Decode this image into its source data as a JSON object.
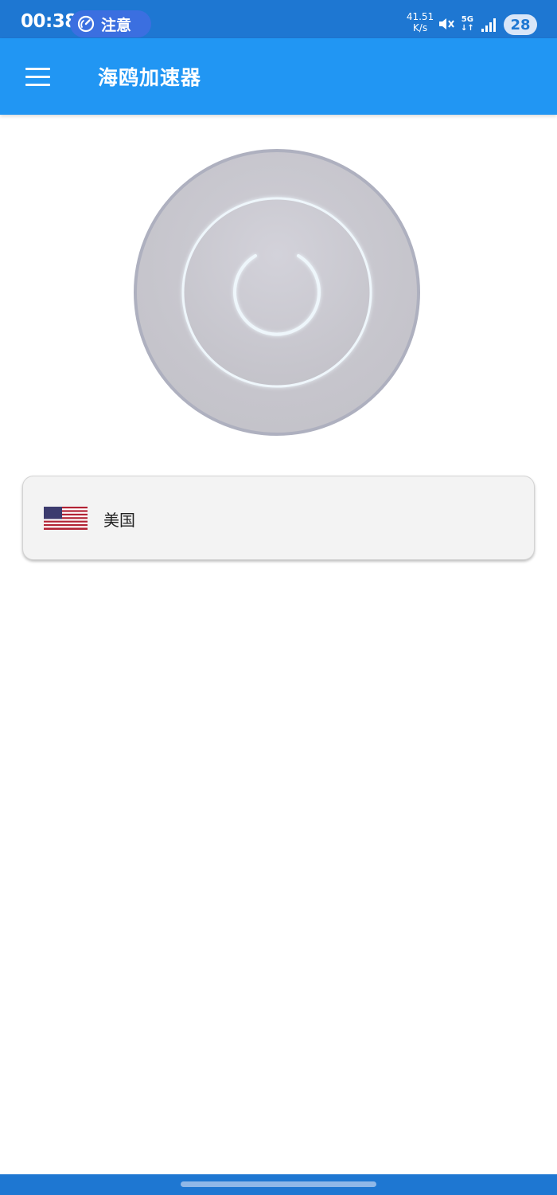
{
  "status_bar": {
    "time": "00:38",
    "notice_label": "注意",
    "net_speed_value": "41.51",
    "net_speed_unit": "K/s",
    "network_type": "5G",
    "battery_level": "28",
    "colors": {
      "background": "#1e77d2",
      "pill": "#3b6fe0"
    }
  },
  "app_bar": {
    "title": "海鸥加速器",
    "menu_icon": "hamburger-menu-icon",
    "color": "#2196f3"
  },
  "power": {
    "icon": "power-icon",
    "state": "disconnected"
  },
  "server": {
    "country": "美国",
    "flag_icon": "us-flag-icon"
  }
}
